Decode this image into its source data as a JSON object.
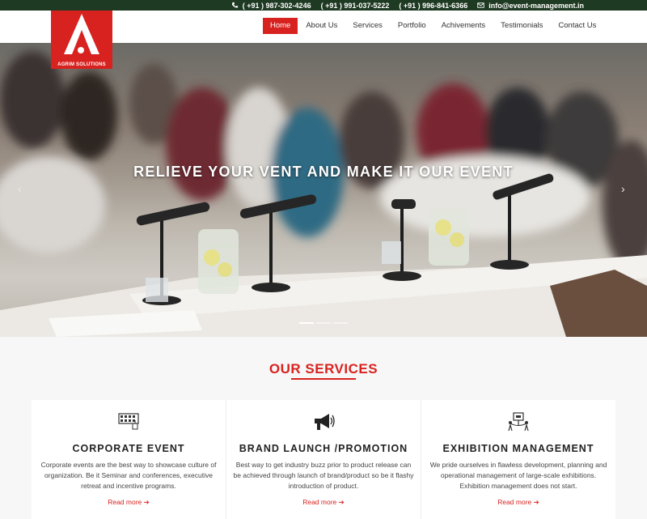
{
  "topbar": {
    "phones": [
      "( +91 ) 987-302-4246",
      "( +91 ) 991-037-5222",
      "( +91 ) 996-841-6366"
    ],
    "email": "info@event-management.in"
  },
  "logo": {
    "text": "AGRIM SOLUTIONS"
  },
  "nav": {
    "items": [
      "Home",
      "About Us",
      "Services",
      "Portfolio",
      "Achivements",
      "Testimonials",
      "Contact Us"
    ]
  },
  "hero": {
    "caption": "RELIEVE YOUR VENT AND MAKE IT OUR EVENT",
    "prev": "‹",
    "next": "›"
  },
  "services": {
    "title": "OUR SERVICES",
    "cards": [
      {
        "title": "CORPORATE EVENT",
        "text": "Corporate events are the best way to showcase culture of organization. Be it Seminar and conferences, executive retreat and incentive programs.",
        "link": "Read more",
        "icon": "conference-icon"
      },
      {
        "title": "BRAND LAUNCH /PROMOTION",
        "text": "Best way to get industry buzz prior to product release can be achieved through launch of brand/product so be it flashy introduction of product.",
        "link": "Read more",
        "icon": "megaphone-icon"
      },
      {
        "title": "EXHIBITION MANAGEMENT",
        "text": "We pride ourselves in flawless development, planning and operational management of large-scale exhibitions. Exhibition management does not start.",
        "link": "Read more",
        "icon": "exhibition-icon"
      }
    ]
  }
}
